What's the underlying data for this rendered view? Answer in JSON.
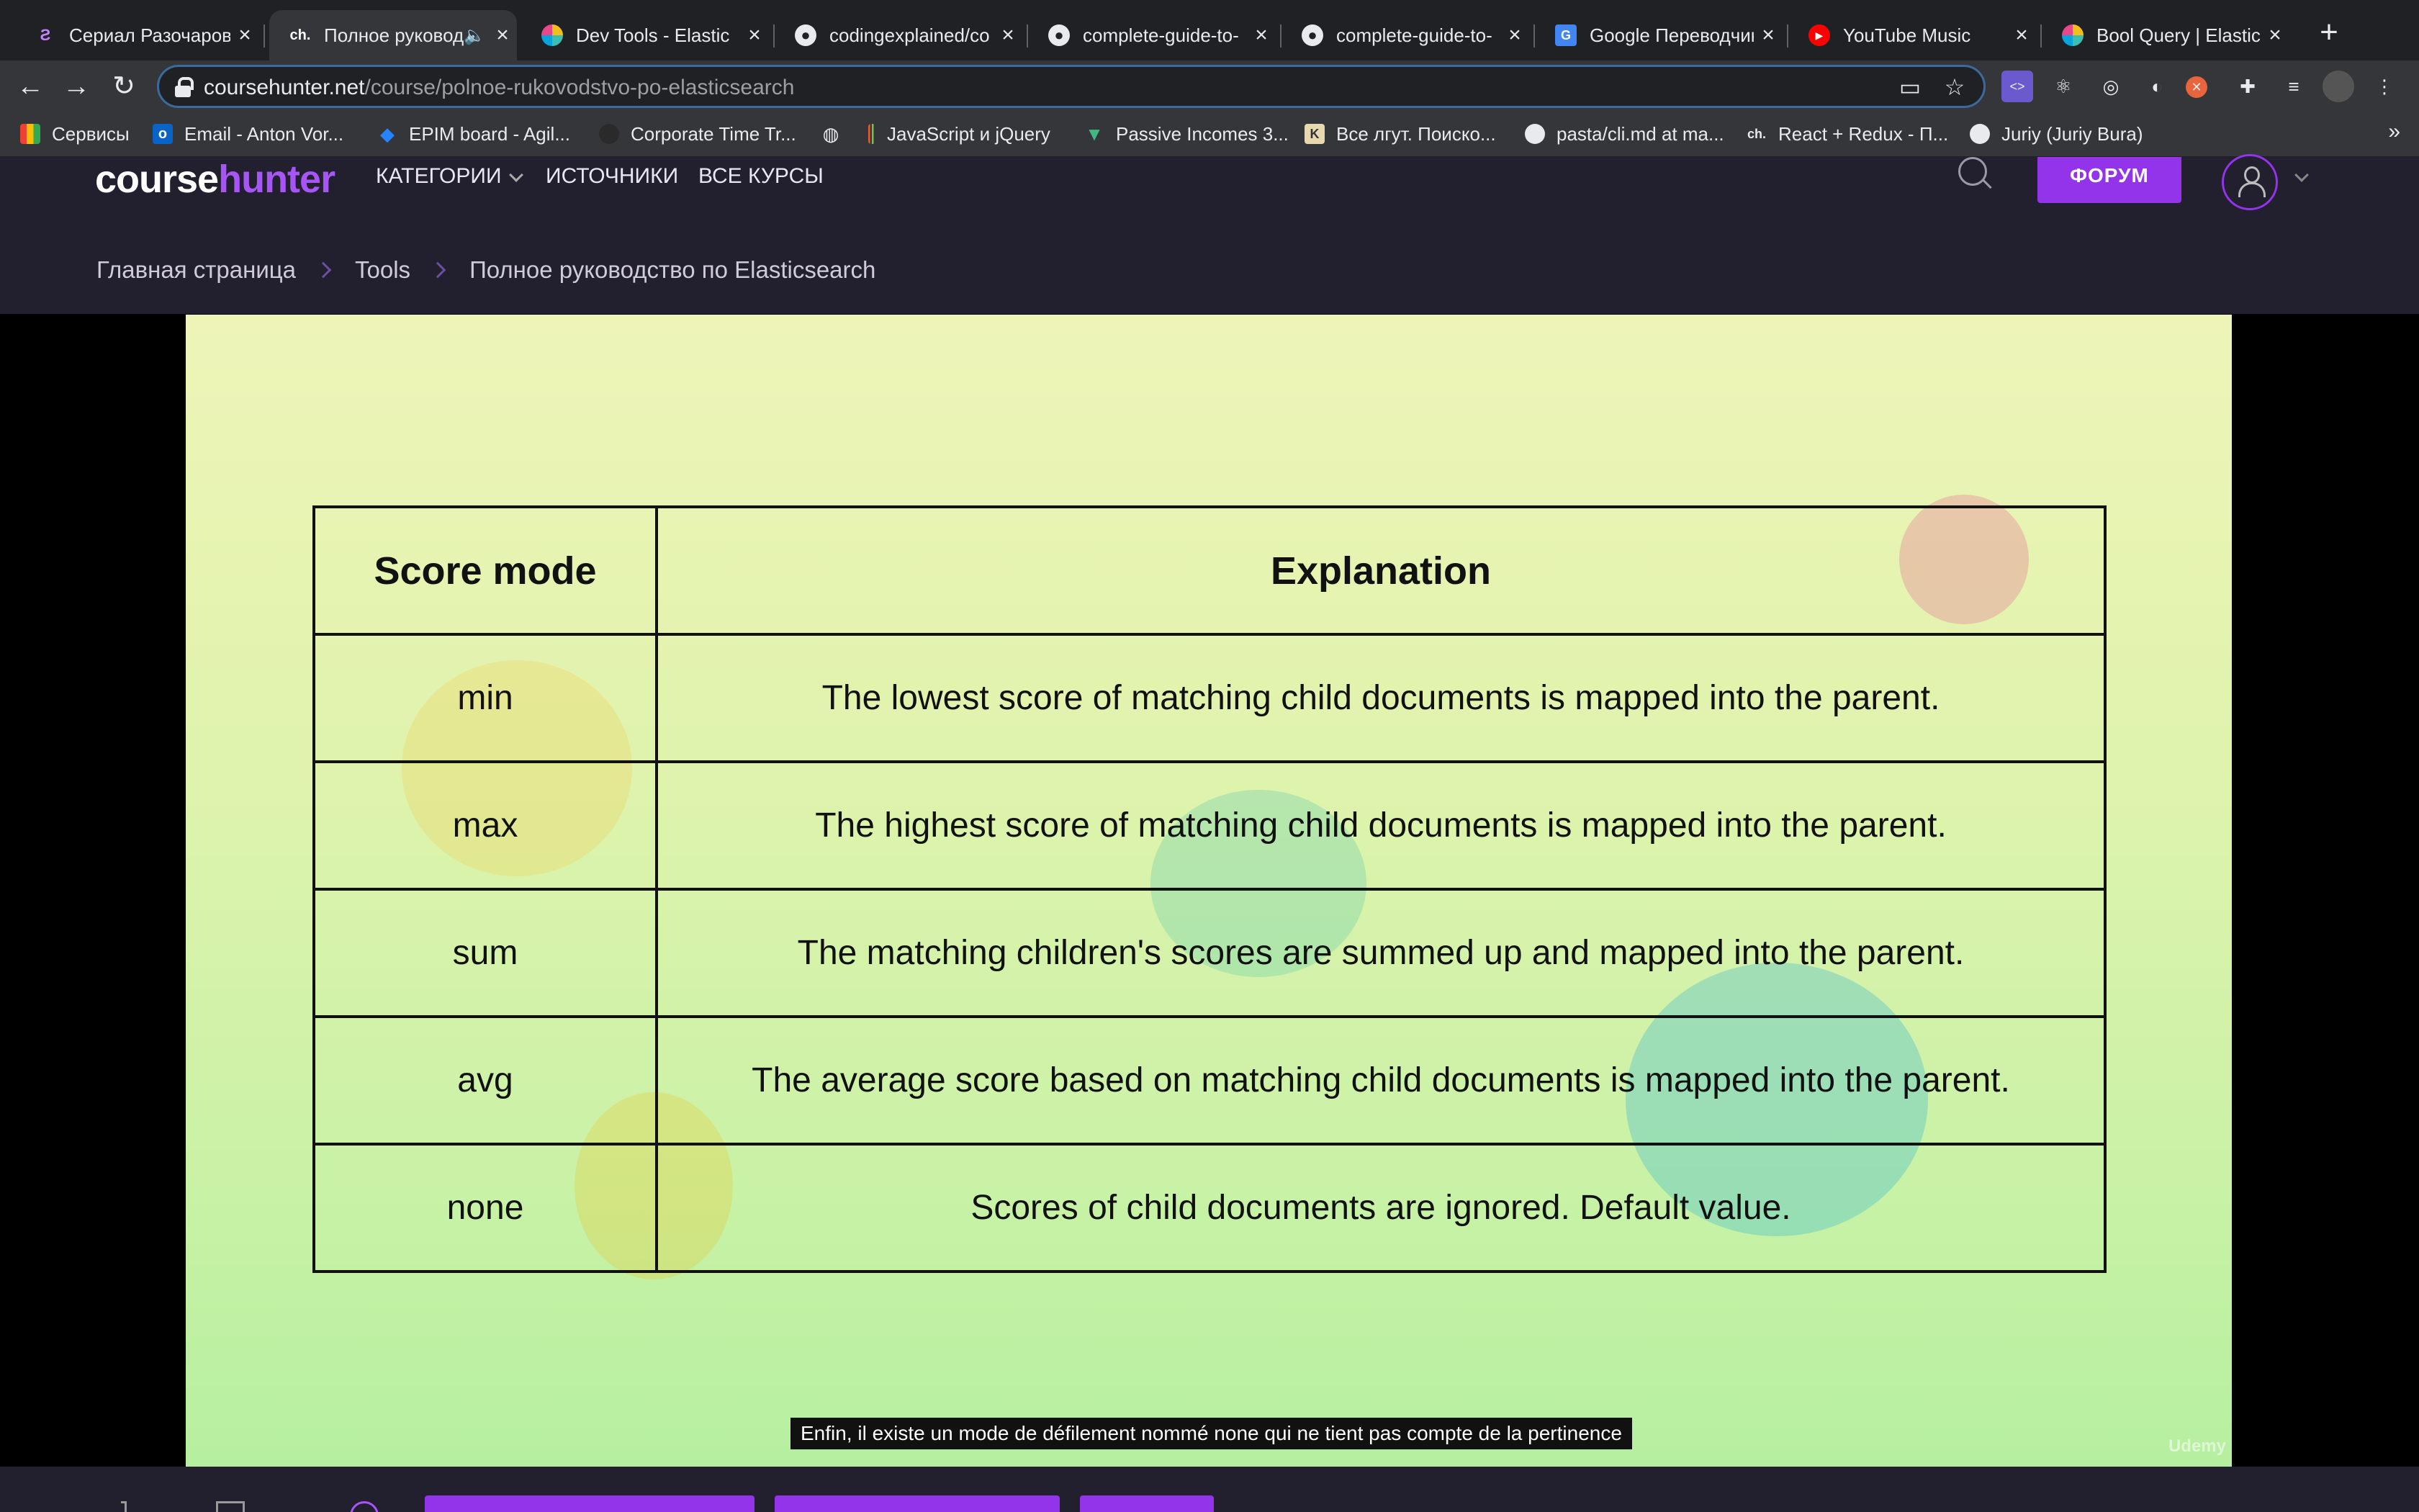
{
  "browser": {
    "tabs": [
      {
        "title": "Сериал Разочарование",
        "favicon": "series-icon",
        "active": false
      },
      {
        "title": "Полное руководство",
        "favicon": "coursehunter-icon",
        "active": true,
        "audio": true
      },
      {
        "title": "Dev Tools - Elastic",
        "favicon": "elastic-icon",
        "active": false
      },
      {
        "title": "codingexplained/co",
        "favicon": "github-icon",
        "active": false
      },
      {
        "title": "complete-guide-to-",
        "favicon": "github-icon",
        "active": false
      },
      {
        "title": "complete-guide-to-",
        "favicon": "github-icon",
        "active": false
      },
      {
        "title": "Google Переводчик",
        "favicon": "google-translate-icon",
        "active": false
      },
      {
        "title": "YouTube Music",
        "favicon": "youtube-music-icon",
        "active": false
      },
      {
        "title": "Bool Query | Elastic",
        "favicon": "elastic-icon",
        "active": false
      }
    ],
    "url_host": "coursehunter.net",
    "url_path": "/course/polnoe-rukovodstvo-po-elasticsearch",
    "bookmarks": [
      {
        "label": "Сервисы",
        "icon": "apps-grid-icon"
      },
      {
        "label": "Email - Anton Vor...",
        "icon": "outlook-icon"
      },
      {
        "label": "EPIM board - Agil...",
        "icon": "jira-icon"
      },
      {
        "label": "Corporate Time Tr...",
        "icon": "clock-icon"
      },
      {
        "label": "",
        "icon": "globe-icon"
      },
      {
        "label": "JavaScript и jQuery",
        "icon": "bookmark-icon"
      },
      {
        "label": "Passive Incomes 3...",
        "icon": "vue-icon"
      },
      {
        "label": "Все лгут. Поиско...",
        "icon": "book-icon"
      },
      {
        "label": "pasta/cli.md at ma...",
        "icon": "github-icon"
      },
      {
        "label": "React + Redux - П...",
        "icon": "coursehunter-icon"
      },
      {
        "label": "Juriy (Juriy Bura)",
        "icon": "github-icon"
      }
    ],
    "bookmarks_more": "»"
  },
  "site": {
    "logo_course": "course",
    "logo_hunter": "hunter",
    "nav": {
      "categories": "КАТЕГОРИИ",
      "sources": "ИСТОЧНИКИ",
      "all_courses": "ВСЕ КУРСЫ"
    },
    "forum_button": "ФОРУМ",
    "breadcrumb": [
      "Главная страница",
      "Tools",
      "Полное руководство по Elasticsearch"
    ]
  },
  "video": {
    "table": {
      "headers": [
        "Score mode",
        "Explanation"
      ],
      "rows": [
        [
          "min",
          "The lowest score of matching child documents is mapped into the parent."
        ],
        [
          "max",
          "The highest score of matching child documents is mapped into the parent."
        ],
        [
          "sum",
          "The matching children's scores are summed up and mapped into the parent."
        ],
        [
          "avg",
          "The average score based on matching child documents is mapped into the parent."
        ],
        [
          "none",
          "Scores of child documents are ignored. Default value."
        ]
      ]
    },
    "subtitle": "Enfin, il existe un mode de défilement nommé none qui ne tient pas compte de la pertinence",
    "watermark": "Udemy"
  },
  "colors": {
    "accent": "#9333ea",
    "site_bg": "#221f2e",
    "chrome_bg": "#202124",
    "chrome_toolbar": "#35363a"
  }
}
